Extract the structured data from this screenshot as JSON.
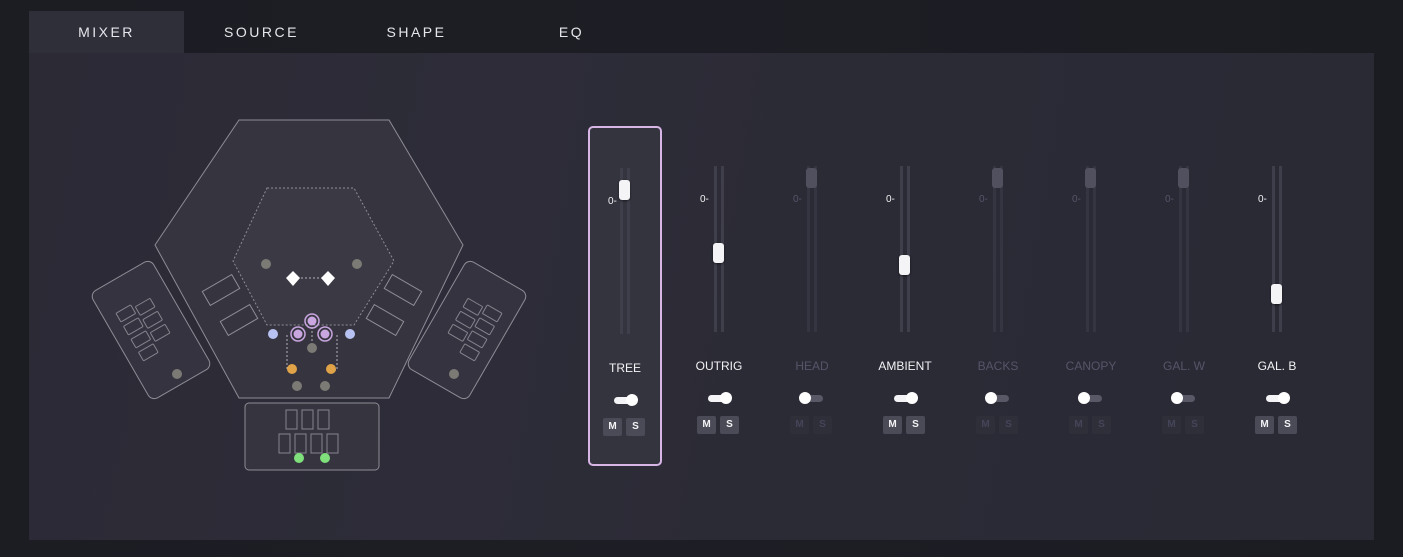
{
  "tabs": [
    {
      "label": "MIXER",
      "active": true
    },
    {
      "label": "SOURCE",
      "active": false
    },
    {
      "label": "SHAPE",
      "active": false
    },
    {
      "label": "EQ",
      "active": false
    }
  ],
  "channels": [
    {
      "label": "TREE",
      "zero_label": "0-",
      "level": 0.93,
      "enabled": true,
      "selected": true,
      "toggle_on": true,
      "mute_label": "M",
      "solo_label": "S"
    },
    {
      "label": "OUTRIG",
      "zero_label": "0-",
      "level": 0.45,
      "enabled": true,
      "selected": false,
      "toggle_on": true,
      "mute_label": "M",
      "solo_label": "S"
    },
    {
      "label": "HEAD",
      "zero_label": "0-",
      "level": 1.0,
      "enabled": false,
      "selected": false,
      "toggle_on": false,
      "mute_label": "M",
      "solo_label": "S"
    },
    {
      "label": "AMBIENT",
      "zero_label": "0-",
      "level": 0.36,
      "enabled": true,
      "selected": false,
      "toggle_on": true,
      "mute_label": "M",
      "solo_label": "S"
    },
    {
      "label": "BACKS",
      "zero_label": "0-",
      "level": 1.0,
      "enabled": false,
      "selected": false,
      "toggle_on": false,
      "mute_label": "M",
      "solo_label": "S"
    },
    {
      "label": "CANOPY",
      "zero_label": "0-",
      "level": 1.0,
      "enabled": false,
      "selected": false,
      "toggle_on": false,
      "mute_label": "M",
      "solo_label": "S"
    },
    {
      "label": "GAL. W",
      "zero_label": "0-",
      "level": 1.0,
      "enabled": false,
      "selected": false,
      "toggle_on": false,
      "mute_label": "M",
      "solo_label": "S"
    },
    {
      "label": "GAL. B",
      "zero_label": "0-",
      "level": 0.15,
      "enabled": true,
      "selected": false,
      "toggle_on": true,
      "mute_label": "M",
      "solo_label": "S"
    }
  ],
  "colors": {
    "selected_border": "#d7b6e6",
    "mic_purple": "#c9a6e0",
    "mic_blue": "#b8c2f2",
    "mic_orange": "#e0a347",
    "mic_green": "#7fe07c",
    "mic_grey": "#7c7a74"
  }
}
